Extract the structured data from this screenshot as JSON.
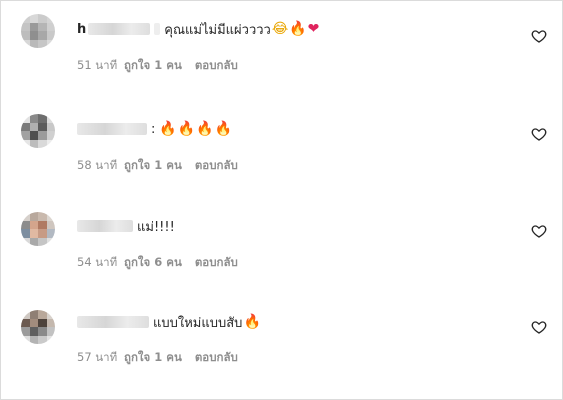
{
  "comments": [
    {
      "username_prefix": "h",
      "text": "คุณแม่ไม่มีแผ่วววว",
      "emojis": [
        {
          "char": "😂",
          "class": "grin"
        },
        {
          "char": "🔥",
          "class": "fire"
        },
        {
          "char": "❤",
          "class": "heart"
        }
      ],
      "time": "51 นาที",
      "likes": "ถูกใจ 1 คน",
      "reply": "ตอบกลับ"
    },
    {
      "username_prefix": "",
      "text": ":",
      "emojis": [
        {
          "char": "🔥",
          "class": "fire"
        },
        {
          "char": "🔥",
          "class": "fire"
        },
        {
          "char": "🔥",
          "class": "fire"
        },
        {
          "char": "🔥",
          "class": "fire"
        }
      ],
      "time": "58 นาที",
      "likes": "ถูกใจ 1 คน",
      "reply": "ตอบกลับ"
    },
    {
      "username_prefix": "",
      "text": "แม่!!!!",
      "emojis": [],
      "time": "54 นาที",
      "likes": "ถูกใจ 6 คน",
      "reply": "ตอบกลับ"
    },
    {
      "username_prefix": "",
      "text": "แบบใหม่แบบสับ",
      "emojis": [
        {
          "char": "🔥",
          "class": "fire"
        }
      ],
      "time": "57 นาที",
      "likes": "ถูกใจ 1 คน",
      "reply": "ตอบกลับ"
    }
  ],
  "colors": {
    "text": "#262626",
    "meta": "#8e8e8e",
    "border": "#dbdbdb"
  },
  "icons": {
    "like": "heart-outline-icon"
  }
}
